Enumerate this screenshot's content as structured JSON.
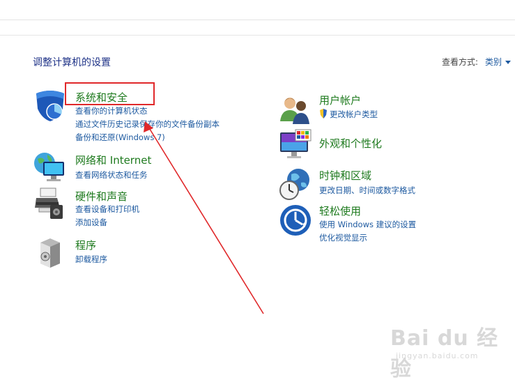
{
  "header": {
    "title": "调整计算机的设置",
    "view_label": "查看方式:",
    "view_value": "类别"
  },
  "categories": {
    "system": {
      "title": "系统和安全",
      "links": [
        "查看你的计算机状态",
        "通过文件历史记录保存你的文件备份副本",
        "备份和还原(Windows 7)"
      ]
    },
    "network": {
      "title": "网络和 Internet",
      "links": [
        "查看网络状态和任务"
      ]
    },
    "hardware": {
      "title": "硬件和声音",
      "links": [
        "查看设备和打印机",
        "添加设备"
      ]
    },
    "programs": {
      "title": "程序",
      "links": [
        "卸载程序"
      ]
    },
    "users": {
      "title": "用户帐户",
      "links": [
        "更改帐户类型"
      ]
    },
    "appearance": {
      "title": "外观和个性化",
      "links": []
    },
    "clock": {
      "title": "时钟和区域",
      "links": [
        "更改日期、时间或数字格式"
      ]
    },
    "ease": {
      "title": "轻松使用",
      "links": [
        "使用 Windows 建议的设置",
        "优化视觉显示"
      ]
    }
  },
  "watermark": {
    "brand": "Bai du 经验",
    "url": "jingyan.baidu.com"
  },
  "colors": {
    "title_green": "#1e7a1e",
    "link_blue": "#1e5aa0",
    "annotation_red": "#e0282a"
  }
}
